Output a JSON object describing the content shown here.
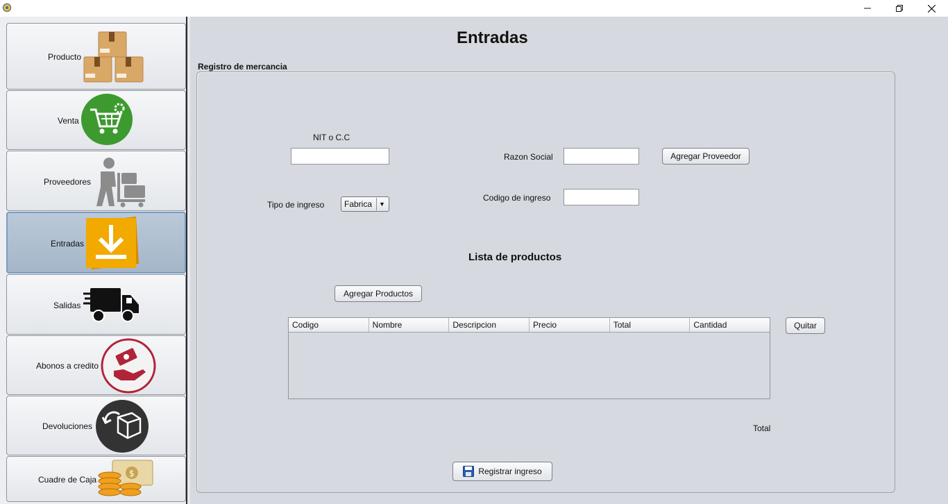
{
  "window": {
    "minimize_icon": "minimize-icon",
    "restore_icon": "restore-icon",
    "close_icon": "close-icon"
  },
  "sidebar": {
    "items": [
      {
        "label": "Producto",
        "icon": "boxes-icon"
      },
      {
        "label": "Venta",
        "icon": "cart-icon"
      },
      {
        "label": "Proveedores",
        "icon": "delivery-person-icon"
      },
      {
        "label": "Entradas",
        "icon": "download-icon",
        "active": true
      },
      {
        "label": "Salidas",
        "icon": "truck-icon"
      },
      {
        "label": "Abonos a credito",
        "icon": "payment-hand-icon"
      },
      {
        "label": "Devoluciones",
        "icon": "return-box-icon"
      },
      {
        "label": "Cuadre de Caja",
        "icon": "coins-cash-icon"
      }
    ]
  },
  "main": {
    "title": "Entradas",
    "panel_title": "Registro de mercancia",
    "form": {
      "nit_label": "NIT o C.C",
      "nit_value": "",
      "razon_label": "Razon Social",
      "razon_value": "",
      "agregar_proveedor": "Agregar Proveedor",
      "tipo_label": "Tipo de ingreso",
      "tipo_value": "Fabrica",
      "codigo_label": "Codigo de ingreso",
      "codigo_value": ""
    },
    "productos": {
      "title": "Lista de productos",
      "agregar_productos": "Agregar Productos",
      "columns": [
        "Codigo",
        "Nombre",
        "Descripcion",
        "Precio",
        "Total",
        "Cantidad"
      ],
      "rows": [],
      "quitar": "Quitar"
    },
    "total_label": "Total",
    "registrar": "Registrar ingreso"
  },
  "colors": {
    "background": "#d6d9df",
    "active_nav": "#a5b6c8",
    "venta_green": "#3c9a2e",
    "entradas_orange": "#f2a900",
    "abonos_red": "#b0243a",
    "devoluciones_dark": "#333333"
  }
}
